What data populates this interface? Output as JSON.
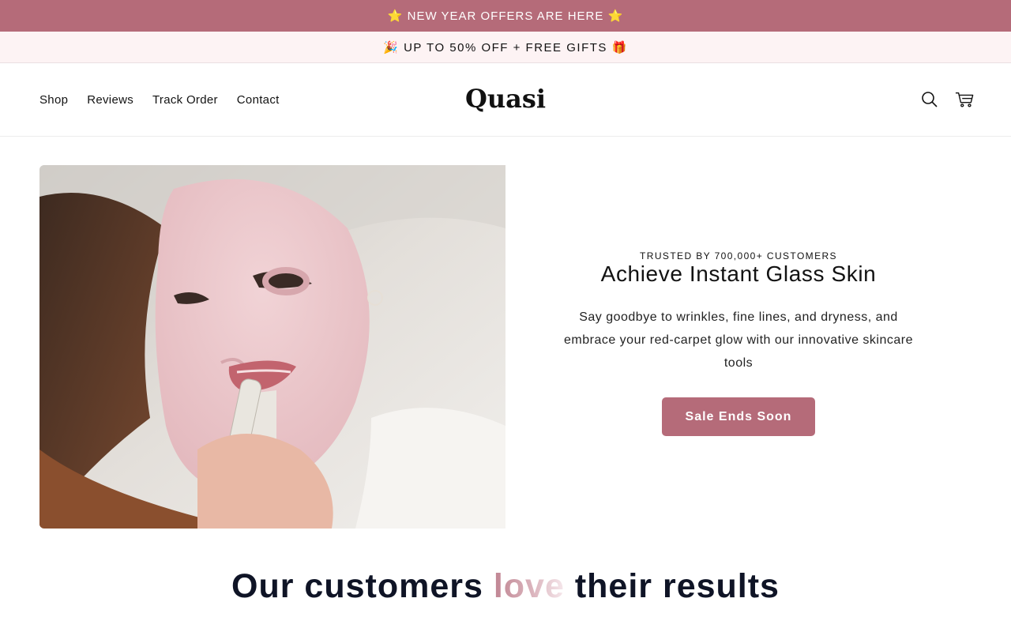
{
  "announcements": {
    "primary": "⭐ NEW YEAR OFFERS ARE HERE ⭐",
    "secondary": "🎉 UP TO 50% OFF + FREE GIFTS 🎁"
  },
  "header": {
    "nav": [
      "Shop",
      "Reviews",
      "Track Order",
      "Contact"
    ],
    "logo": "Quasi",
    "icons": [
      "search-icon",
      "cart-icon"
    ]
  },
  "hero": {
    "eyebrow": "TRUSTED BY 700,000+ CUSTOMERS",
    "title": "Achieve Instant Glass Skin",
    "description": "Say goodbye to wrinkles, fine lines, and dryness, and embrace your red-carpet glow with our innovative skincare tools",
    "cta_label": "Sale Ends Soon",
    "image_alt": "Woman wearing a pink LED face mask holding a skincare tool"
  },
  "results": {
    "title_before": "Our customers ",
    "title_highlight": "love",
    "title_after": " their results"
  },
  "colors": {
    "brand": "#b56b79",
    "announcement_light": "#fdf3f4",
    "heading_dark": "#0f1426"
  }
}
